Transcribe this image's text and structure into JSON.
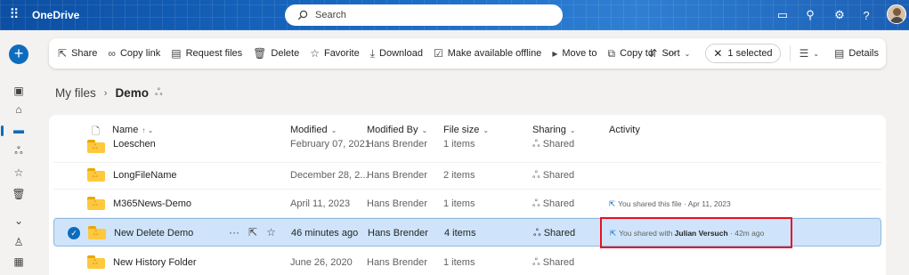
{
  "app": {
    "name": "OneDrive"
  },
  "search": {
    "placeholder": "Search"
  },
  "toolbar": {
    "share": "Share",
    "copy_link": "Copy link",
    "request_files": "Request files",
    "delete": "Delete",
    "favorite": "Favorite",
    "download": "Download",
    "make_offline": "Make available offline",
    "move_to": "Move to",
    "copy_to": "Copy to",
    "more": "···",
    "sort": "Sort",
    "selected": "1 selected",
    "details": "Details"
  },
  "breadcrumb": {
    "root": "My files",
    "current": "Demo"
  },
  "columns": {
    "name": "Name",
    "modified": "Modified",
    "modified_by": "Modified By",
    "file_size": "File size",
    "sharing": "Sharing",
    "activity": "Activity"
  },
  "rows": [
    {
      "name": "Loeschen",
      "modified": "February 07, 2021",
      "modified_by": "Hans Brender",
      "size": "1 items",
      "sharing": "Shared",
      "activity": ""
    },
    {
      "name": "LongFileName",
      "modified": "December 28, 2...",
      "modified_by": "Hans Brender",
      "size": "2 items",
      "sharing": "Shared",
      "activity": ""
    },
    {
      "name": "M365News-Demo",
      "modified": "April 11, 2023",
      "modified_by": "Hans Brender",
      "size": "1 items",
      "sharing": "Shared",
      "activity": "You shared this file · Apr 11, 2023"
    },
    {
      "name": "New Delete Demo",
      "modified": "46 minutes ago",
      "modified_by": "Hans Brender",
      "size": "4 items",
      "sharing": "Shared",
      "activity_prefix": "You shared with ",
      "activity_person": "Julian Versuch",
      "activity_suffix": " · 42m ago",
      "selected": true
    },
    {
      "name": "New History Folder",
      "modified": "June 26, 2020",
      "modified_by": "Hans Brender",
      "size": "1 items",
      "sharing": "Shared",
      "activity": ""
    }
  ],
  "icons": {
    "app_launcher": "waffle-icon",
    "search": "search-icon",
    "sharing": "people-icon"
  },
  "colors": {
    "brand": "#0f6cbd",
    "selection": "#cfe4fa",
    "highlight": "#e81123",
    "folder": "#ffc83d"
  }
}
